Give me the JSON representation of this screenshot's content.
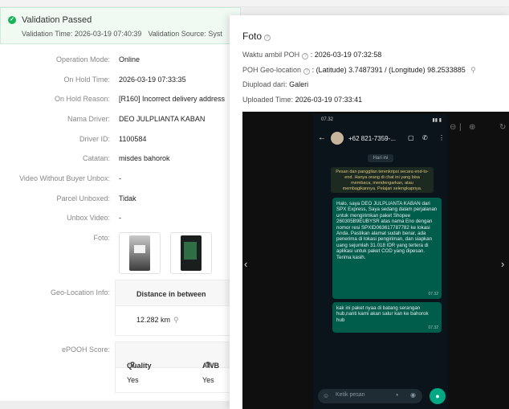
{
  "banner": {
    "title": "Validation Passed",
    "validation_time": "Validation Time: 2026-03-19 07:40:39",
    "validation_source": "Validation Source: Syst"
  },
  "details": [
    {
      "label": "Operation Mode:",
      "value": "Online"
    },
    {
      "label": "On Hold Time:",
      "value": "2026-03-19 07:33:35"
    },
    {
      "label": "On Hold Reason:",
      "value": "[R160] Incorrect delivery address"
    },
    {
      "label": "Nama Driver:",
      "value": "DEO JULPLIANTA KABAN"
    },
    {
      "label": "Driver ID:",
      "value": "1100584"
    },
    {
      "label": "Catatan:",
      "value": "misdes bahorok"
    },
    {
      "label": "Video Without Buyer Unbox:",
      "value": "-"
    },
    {
      "label": "Parcel Unboxed:",
      "value": "Tidak"
    },
    {
      "label": "Unbox Video:",
      "value": "-"
    },
    {
      "label": "Foto:",
      "value": ""
    }
  ],
  "geo": {
    "label": "Geo-Location Info:",
    "header": "Distance in between",
    "value": "12.282 km"
  },
  "epooh": {
    "label": "ePOOH Score:",
    "col_quality": "Quality",
    "col_awb": "AWB",
    "quality_value": "Yes",
    "awb_value": "Yes"
  },
  "drawer": {
    "title": "Foto",
    "waktu_label": "Waktu ambil POH",
    "waktu_value": ": 2026-03-19 07:32:58",
    "geo_label": "POH Geo-location",
    "geo_value": ": (Latitude) 3.7487391 / (Longitude) 98.2533885",
    "diupload_label": "Diupload dari:",
    "diupload_value": "Galeri",
    "uploaded_label": "Uploaded Time:",
    "uploaded_value": "2026-03-19 07:33:41"
  },
  "phone": {
    "status_time": "07.32",
    "contact": "+62 821-7359-...",
    "date_chip": "Hari ini",
    "system_note": "Pesan dan panggilan terenkripsi secara end-to-end. Hanya orang di chat ini yang bisa membaca, mendengarkan, atau membagikannya. Pelajari selengkapnya.",
    "message1": "Halo, saya DEO JULPLIANTA KABAN dari SPX Express, Saya sedang dalam perjalanan untuk mengirimkan paket Shopee 260305B9EUBYSR atas nama Eno  dengan nomor resi SPXID063617787782  ke lokasi Anda. Pastikan alamat sudah benar, ada penerima di lokasi pengiriman, dan siapkan uang sejumlah 31.018 IDR yang tertera di aplikasi untuk paket COD yang dipesan. Terima kasih.",
    "message1_time": "07.32",
    "message2": "kak ini paket nyaa di batang serangan hub,nanti kami akan salur kan ke bahorok hub",
    "message2_time": "07.32",
    "input_placeholder": "Ketik pesan"
  },
  "colors": {
    "success": "#1bb25a",
    "whatsapp_bubble": "#005c4b",
    "whatsapp_bg": "#0b141a"
  }
}
